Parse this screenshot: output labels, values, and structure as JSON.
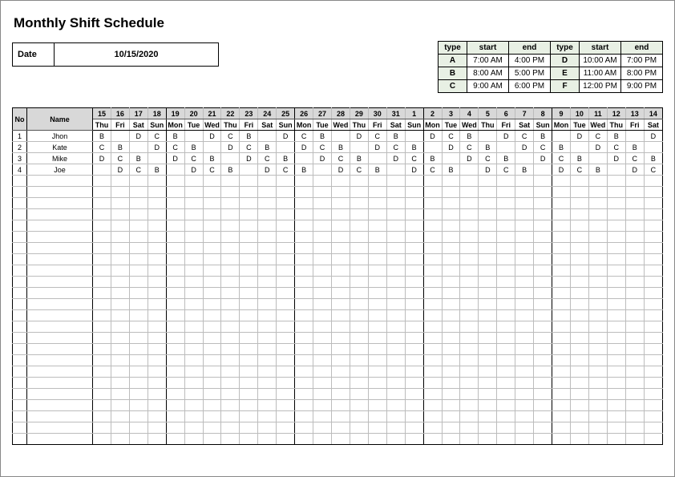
{
  "title": "Monthly Shift Schedule",
  "date_label": "Date",
  "date_value": "10/15/2020",
  "types_header": [
    "type",
    "start",
    "end",
    "type",
    "start",
    "end"
  ],
  "types_rows": [
    [
      "A",
      "7:00 AM",
      "4:00 PM",
      "D",
      "10:00 AM",
      "7:00 PM"
    ],
    [
      "B",
      "8:00 AM",
      "5:00 PM",
      "E",
      "11:00 AM",
      "8:00 PM"
    ],
    [
      "C",
      "9:00 AM",
      "6:00 PM",
      "F",
      "12:00 PM",
      "9:00 PM"
    ]
  ],
  "schedule": {
    "no_label": "No",
    "name_label": "Name",
    "days": [
      "15",
      "16",
      "17",
      "18",
      "19",
      "20",
      "21",
      "22",
      "23",
      "24",
      "25",
      "26",
      "27",
      "28",
      "29",
      "30",
      "31",
      "1",
      "2",
      "3",
      "4",
      "5",
      "6",
      "7",
      "8",
      "9",
      "10",
      "11",
      "12",
      "13",
      "14"
    ],
    "weekdays": [
      "Thu",
      "Fri",
      "Sat",
      "Sun",
      "Mon",
      "Tue",
      "Wed",
      "Thu",
      "Fri",
      "Sat",
      "Sun",
      "Mon",
      "Tue",
      "Wed",
      "Thu",
      "Fri",
      "Sat",
      "Sun",
      "Mon",
      "Tue",
      "Wed",
      "Thu",
      "Fri",
      "Sat",
      "Sun",
      "Mon",
      "Tue",
      "Wed",
      "Thu",
      "Fri",
      "Sat"
    ],
    "rows": [
      {
        "no": "1",
        "name": "Jhon",
        "cells": [
          "B",
          "",
          "D",
          "C",
          "B",
          "",
          "D",
          "C",
          "B",
          "",
          "D",
          "C",
          "B",
          "",
          "D",
          "C",
          "B",
          "",
          "D",
          "C",
          "B",
          "",
          "D",
          "C",
          "B",
          "",
          "D",
          "C",
          "B",
          "",
          "D"
        ]
      },
      {
        "no": "2",
        "name": "Kate",
        "cells": [
          "C",
          "B",
          "",
          "D",
          "C",
          "B",
          "",
          "D",
          "C",
          "B",
          "",
          "D",
          "C",
          "B",
          "",
          "D",
          "C",
          "B",
          "",
          "D",
          "C",
          "B",
          "",
          "D",
          "C",
          "B",
          "",
          "D",
          "C",
          "B",
          ""
        ]
      },
      {
        "no": "3",
        "name": "Mike",
        "cells": [
          "D",
          "C",
          "B",
          "",
          "D",
          "C",
          "B",
          "",
          "D",
          "C",
          "B",
          "",
          "D",
          "C",
          "B",
          "",
          "D",
          "C",
          "B",
          "",
          "D",
          "C",
          "B",
          "",
          "D",
          "C",
          "B",
          "",
          "D",
          "C",
          "B"
        ]
      },
      {
        "no": "4",
        "name": "Joe",
        "cells": [
          "",
          "D",
          "C",
          "B",
          "",
          "D",
          "C",
          "B",
          "",
          "D",
          "C",
          "B",
          "",
          "D",
          "C",
          "B",
          "",
          "D",
          "C",
          "B",
          "",
          "D",
          "C",
          "B",
          "",
          "D",
          "C",
          "B",
          "",
          "D",
          "C"
        ]
      }
    ],
    "empty_rows": 24
  }
}
